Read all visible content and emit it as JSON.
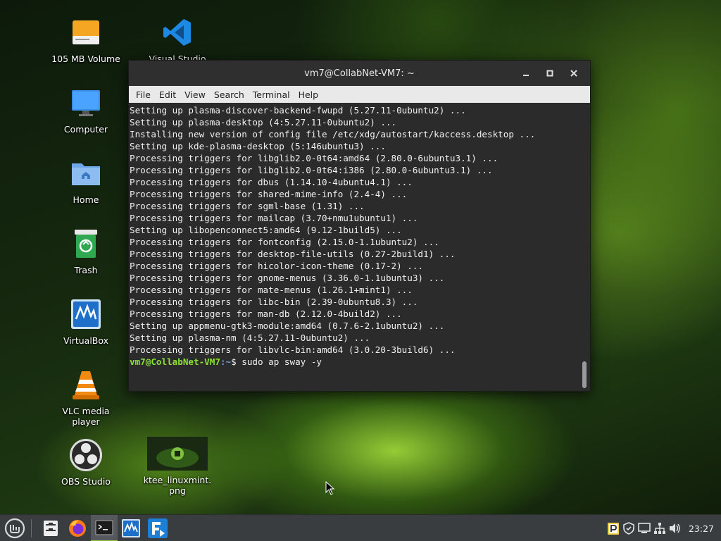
{
  "desktop": {
    "icons": [
      {
        "name": "105 MB Volume"
      },
      {
        "name": "Visual Studio"
      },
      {
        "name": "Computer"
      },
      {
        "name": "Home"
      },
      {
        "name": "Trash"
      },
      {
        "name": "VirtualBox"
      },
      {
        "name": "VLC media player"
      },
      {
        "name": "OBS Studio"
      },
      {
        "name": "ktee_linuxmint.",
        "name2": "png"
      }
    ]
  },
  "terminal": {
    "title": "vm7@CollabNet-VM7: ~",
    "menu": [
      "File",
      "Edit",
      "View",
      "Search",
      "Terminal",
      "Help"
    ],
    "lines": [
      "Setting up plasma-discover-backend-fwupd (5.27.11-0ubuntu2) ...",
      "Setting up plasma-desktop (4:5.27.11-0ubuntu2) ...",
      "Installing new version of config file /etc/xdg/autostart/kaccess.desktop ...",
      "Setting up kde-plasma-desktop (5:146ubuntu3) ...",
      "Processing triggers for libglib2.0-0t64:amd64 (2.80.0-6ubuntu3.1) ...",
      "Processing triggers for libglib2.0-0t64:i386 (2.80.0-6ubuntu3.1) ...",
      "Processing triggers for dbus (1.14.10-4ubuntu4.1) ...",
      "Processing triggers for shared-mime-info (2.4-4) ...",
      "Processing triggers for sgml-base (1.31) ...",
      "Processing triggers for mailcap (3.70+nmu1ubuntu1) ...",
      "Setting up libopenconnect5:amd64 (9.12-1build5) ...",
      "Processing triggers for fontconfig (2.15.0-1.1ubuntu2) ...",
      "Processing triggers for desktop-file-utils (0.27-2build1) ...",
      "Processing triggers for hicolor-icon-theme (0.17-2) ...",
      "Processing triggers for gnome-menus (3.36.0-1.1ubuntu3) ...",
      "Processing triggers for mate-menus (1.26.1+mint1) ...",
      "Processing triggers for libc-bin (2.39-0ubuntu8.3) ...",
      "Processing triggers for man-db (2.12.0-4build2) ...",
      "Setting up appmenu-gtk3-module:amd64 (0.7.6-2.1ubuntu2) ...",
      "Setting up plasma-nm (4:5.27.11-0ubuntu2) ...",
      "Processing triggers for libvlc-bin:amd64 (3.0.20-3build6) ..."
    ],
    "prompt_user": "vm7@CollabNet-VM7",
    "prompt_path": ":~",
    "prompt_symbol": "$ ",
    "command": "sudo ap sway -y"
  },
  "taskbar": {
    "clock": "23:27"
  },
  "colors": {
    "accent": "#8fc63f",
    "prompt_user": "#8ae234",
    "prompt_path": "#729fcf"
  }
}
